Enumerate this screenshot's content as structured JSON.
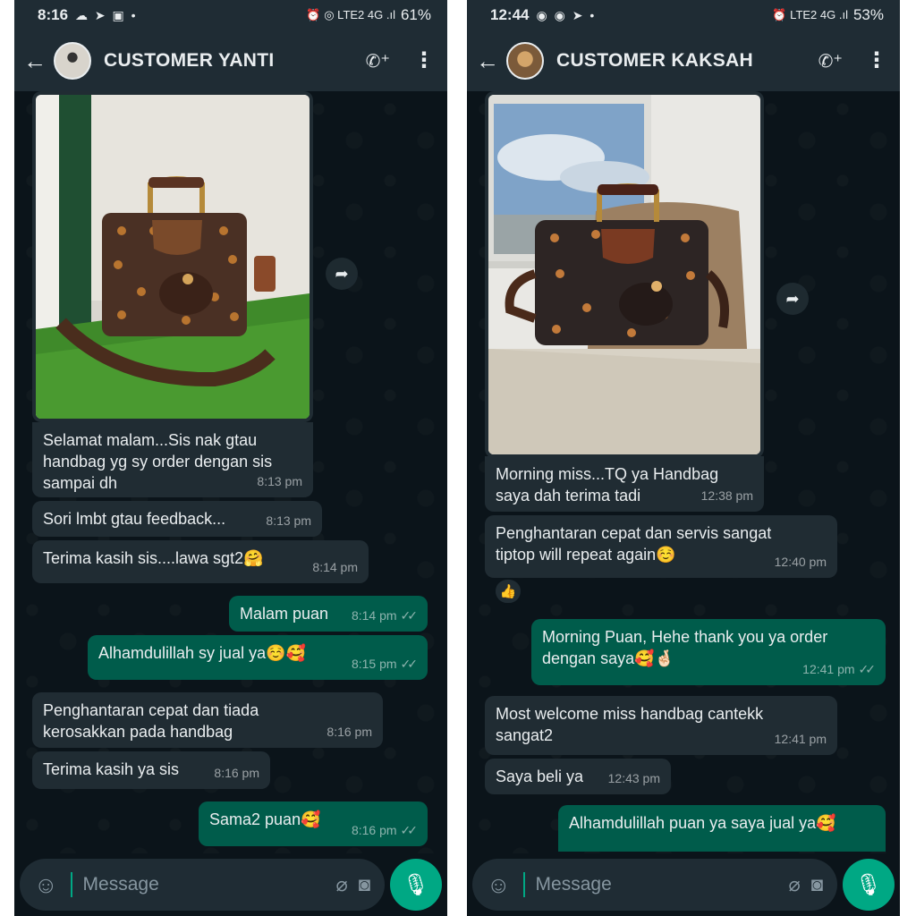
{
  "left": {
    "status": {
      "time": "8:16",
      "icons": "☁ ➤ ▣ •",
      "right": "⏰ ◎ LTE2 4G .ıl",
      "battery": "61%"
    },
    "header": {
      "name": "CUSTOMER YANTI"
    },
    "messages": [
      {
        "text": "Selamat malam...Sis nak gtau\nhandbag yg sy order dengan sis\nsampai dh",
        "time": "8:13 pm"
      },
      {
        "text": "Sori lmbt gtau feedback...",
        "time": "8:13 pm"
      },
      {
        "text": "Terima kasih sis....lawa sgt2🤗",
        "time": "8:14 pm"
      },
      {
        "text": "Malam puan",
        "time": "8:14 pm"
      },
      {
        "text": "Alhamdulillah sy jual ya☺️🥰",
        "time": "8:15 pm"
      },
      {
        "text": "Penghantaran cepat dan tiada\nkerosakkan pada handbag",
        "time": "8:16 pm"
      },
      {
        "text": "Terima kasih ya sis",
        "time": "8:16 pm"
      },
      {
        "text": "Sama2 puan🥰",
        "time": "8:16 pm"
      }
    ],
    "composer": {
      "placeholder": "Message"
    }
  },
  "right": {
    "status": {
      "time": "12:44",
      "icons": "◉ ◉ ➤ •",
      "right": "⏰ LTE2 4G .ıl",
      "battery": "53%"
    },
    "header": {
      "name": "CUSTOMER KAKSAH"
    },
    "messages": [
      {
        "text": "Morning miss...TQ ya Handbag\nsaya dah terima tadi",
        "time": "12:38 pm"
      },
      {
        "text": "Penghantaran cepat dan servis sangat\ntiptop will repeat again☺️",
        "time": "12:40 pm"
      },
      {
        "text": "Morning Puan, Hehe thank you ya order\ndengan saya🥰🤞🏻",
        "time": "12:41 pm"
      },
      {
        "text": "Most welcome miss handbag cantekk\nsangat2",
        "time": "12:41 pm"
      },
      {
        "text": "Saya beli ya",
        "time": "12:43 pm"
      },
      {
        "text": "Alhamdulillah puan ya saya jual ya🥰",
        "time": ""
      }
    ],
    "reaction": "👍",
    "composer": {
      "placeholder": "Message"
    }
  },
  "icons": {
    "back": "back-arrow-icon",
    "call": "add-call-icon",
    "menu": "more-vert-icon",
    "forward": "forward-icon",
    "emoji": "emoji-icon",
    "attach": "paperclip-icon",
    "camera": "camera-icon",
    "mic": "mic-icon",
    "read": "double-check-icon"
  },
  "colors": {
    "background": "#0b141a",
    "header": "#1f2c34",
    "incoming": "#202c33",
    "outgoing": "#005c4b",
    "accent": "#00a884"
  }
}
